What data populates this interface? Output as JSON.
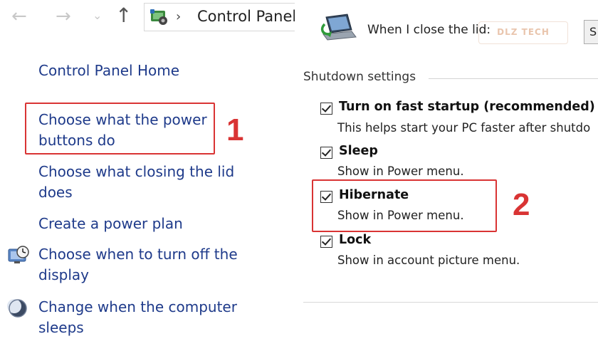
{
  "nav": {
    "back_glyph": "←",
    "forward_glyph": "→",
    "dropdown_glyph": "⌄",
    "up_glyph": "↑",
    "separator": "›",
    "breadcrumb": "Control Panel"
  },
  "sidebar": {
    "home": "Control Panel Home",
    "items": [
      {
        "label": "Choose what the power buttons do",
        "icon": null
      },
      {
        "label": "Choose what closing the lid does",
        "icon": null
      },
      {
        "label": "Create a power plan",
        "icon": null
      },
      {
        "label": "Choose when to turn off the display",
        "icon": "monitor-clock-icon"
      },
      {
        "label": "Change when the computer sleeps",
        "icon": "moon-icon"
      }
    ]
  },
  "annotations": {
    "step1": "1",
    "step2": "2",
    "color": "#d93434"
  },
  "lid": {
    "label": "When I close the lid:",
    "select_value": "S",
    "watermark": "DLZ TECH"
  },
  "shutdown": {
    "title": "Shutdown settings",
    "options": [
      {
        "label": "Turn on fast startup (recommended)",
        "desc": "This helps start your PC faster after shutdo",
        "checked": true
      },
      {
        "label": "Sleep",
        "desc": "Show in Power menu.",
        "checked": true
      },
      {
        "label": "Hibernate",
        "desc": "Show in Power menu.",
        "checked": true
      },
      {
        "label": "Lock",
        "desc": "Show in account picture menu.",
        "checked": true
      }
    ]
  },
  "colors": {
    "link": "#1e3a8a",
    "highlight": "#d93434"
  }
}
